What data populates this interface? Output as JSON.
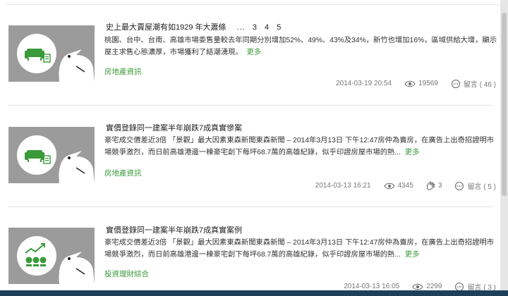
{
  "articles": [
    {
      "title": "史上最大賣屋潮有如1929 年大蕭條",
      "pager": {
        "ellipsis": "...",
        "pages": [
          "3",
          "4",
          "5"
        ]
      },
      "excerpt": "桃園、台中、台南、高雄市場委售量較去年同期分別增加52%、49%、43%及34%，新竹也增加16%，區域供給大增，顯示屋主求售心態濃厚，市場獲利了結潮湧現。",
      "more": "更多",
      "category": "房地產資訊",
      "date": "2014-03-19 20:54",
      "views": "19569",
      "likes": "",
      "comments": "留言 ( 46 )",
      "thumb_icon": "sofa-price-icon"
    },
    {
      "title": "實價登錄同一建案半年崩跌7成真實慘案",
      "excerpt": "豪宅成交價差近3倍 「景觀」最大因素東森新聞東森新聞 – 2014年3月13日 下午12:47房仲為賣房，在廣告上出奇招證明市場競爭激烈，而日前高雄港邊一棟豪宅創下每坪68.7萬的高雄紀錄，似乎印證房屋市場的熱...",
      "more": "更多",
      "category": "房地產資訊",
      "date": "2014-03-13 16:21",
      "views": "4345",
      "likes": "3",
      "comments": "留言 ( 5 )",
      "thumb_icon": "sofa-price-icon"
    },
    {
      "title": "實價登錄同一建案半年崩跌7成真實案例",
      "excerpt": "豪宅成交價差近3倍 「景觀」最大因素東森新聞東森新聞 – 2014年3月13日 下午12:47房仲為賣房，在廣告上出奇招證明市場競爭激烈，而日前高雄港邊一棟豪宅創下每坪68.7萬的高雄紀錄，似乎印證房屋市場的熱...",
      "more": "更多",
      "category": "投資理財綜合",
      "date": "2014-03-13 16:05",
      "views": "2299",
      "likes": "",
      "comments": "留言 ( 3 )",
      "thumb_icon": "coins-chart-icon"
    }
  ],
  "colors": {
    "accent": "#3a9a3a",
    "thumb_bg": "#9b9b9b",
    "taskbar": "#1d3f5a"
  }
}
